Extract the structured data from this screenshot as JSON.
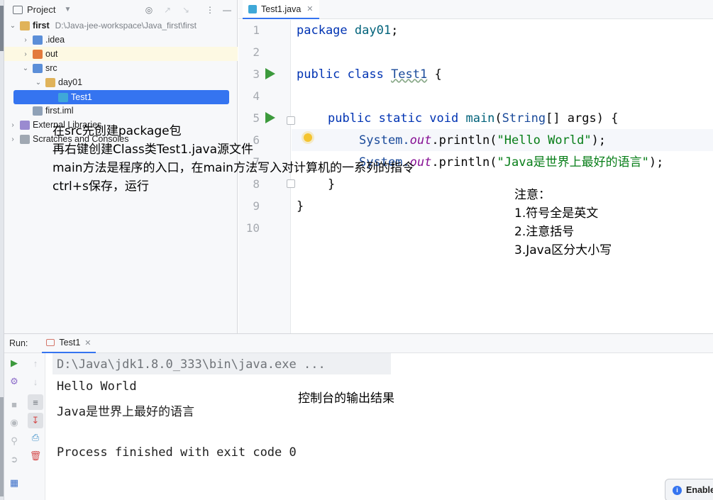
{
  "project": {
    "header_label": "Project",
    "tree": [
      {
        "label": "first",
        "path": "D:\\Java-jee-workspace\\Java_first\\first"
      },
      {
        "label": ".idea"
      },
      {
        "label": "out"
      },
      {
        "label": "src"
      },
      {
        "label": "day01"
      },
      {
        "label": "Test1"
      },
      {
        "label": "first.iml"
      },
      {
        "label": "External Libraries"
      },
      {
        "label": "Scratches and Consoles"
      }
    ]
  },
  "editor": {
    "tab_label": "Test1.java",
    "line_numbers": [
      "1",
      "2",
      "3",
      "4",
      "5",
      "6",
      "7",
      "8",
      "9",
      "10"
    ],
    "code": {
      "l1_kw": "package",
      "l1_pkg": " day01",
      "l1_semi": ";",
      "l3_kw": "public class ",
      "l3_name": "Test1",
      "l3_brace": " {",
      "l5_kw": "public static void ",
      "l5_main": "main",
      "l5_open": "(",
      "l5_type": "String",
      "l5_rest": "[] args) {",
      "l6_sys": "System.",
      "l6_out": "out",
      "l6_call": ".println(",
      "l6_str": "\"Hello World\"",
      "l6_end": ");",
      "l7_sys": "System.",
      "l7_out": "out",
      "l7_call": ".println(",
      "l7_str": "\"Java是世界上最好的语言\"",
      "l7_end": ");",
      "l8": "}",
      "l9": "}"
    }
  },
  "annotations": {
    "left": [
      "在src先创建package包",
      "再右键创建Class类Test1.java源文件",
      "main方法是程序的入口，在main方法写入对计算机的一系列的指令",
      "ctrl+s保存，运行"
    ],
    "right": [
      "注意：",
      "1.符号全是英文",
      "2.注意括号",
      "3.Java区分大小写"
    ],
    "console": "控制台的输出结果"
  },
  "run": {
    "label": "Run:",
    "tab_label": "Test1",
    "output": [
      "D:\\Java\\jdk1.8.0_333\\bin\\java.exe ...",
      "Hello World",
      "Java是世界上最好的语言",
      "Process finished with exit code 0"
    ]
  },
  "toast": {
    "label": "Enable"
  }
}
